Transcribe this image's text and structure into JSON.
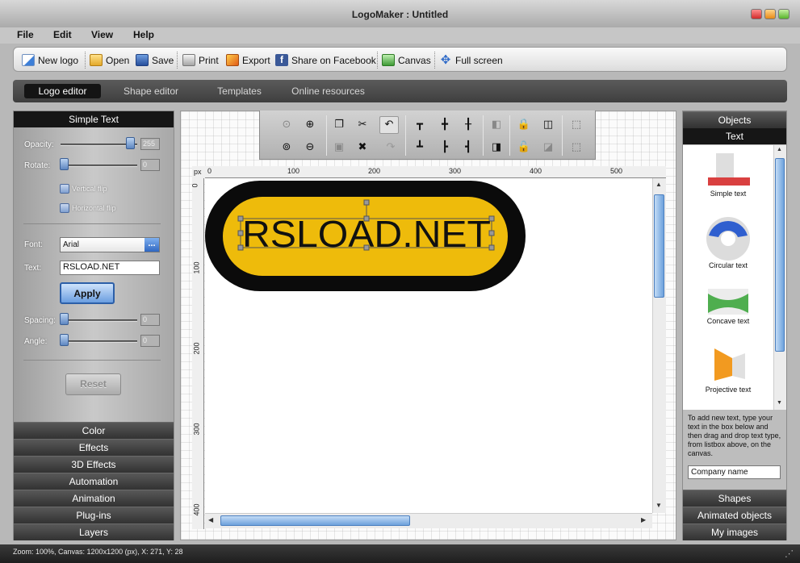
{
  "window": {
    "title": "LogoMaker : Untitled"
  },
  "menu": [
    "File",
    "Edit",
    "View",
    "Help"
  ],
  "toolbar": {
    "new_logo": "New logo",
    "open": "Open",
    "save": "Save",
    "print": "Print",
    "export": "Export",
    "share": "Share on Facebook",
    "canvas": "Canvas",
    "fullscreen": "Full screen"
  },
  "tabs": [
    "Logo editor",
    "Shape editor",
    "Templates",
    "Online resources"
  ],
  "left_panel": {
    "header": "Simple Text",
    "opacity_label": "Opacity:",
    "opacity_value": "255",
    "rotate_label": "Rotate:",
    "rotate_value": "0",
    "vertical_flip": "Vertical flip",
    "horizontal_flip": "Horizontal flip",
    "font_label": "Font:",
    "font_value": "Arial",
    "font_browse": "...",
    "text_label": "Text:",
    "text_value": "RSLOAD.NET",
    "apply": "Apply",
    "spacing_label": "Spacing:",
    "spacing_value": "0",
    "angle_label": "Angle:",
    "angle_value": "0",
    "reset": "Reset",
    "sections": [
      "Color",
      "Effects",
      "3D Effects",
      "Automation",
      "Animation",
      "Plug-ins",
      "Layers"
    ]
  },
  "canvas": {
    "unit": "px",
    "ruler_h": [
      "0",
      "100",
      "200",
      "300",
      "400",
      "500"
    ],
    "ruler_v": [
      "0",
      "100",
      "200",
      "300",
      "400"
    ],
    "logo_text": "RSLOAD.NET",
    "colors": {
      "outer": "#0b0b0b",
      "inner": "#eebb0b",
      "text": "#111111"
    }
  },
  "right_panel": {
    "header": "Objects",
    "subheader": "Text",
    "items": [
      "Simple text",
      "Circular text",
      "Concave text",
      "Projective text"
    ],
    "hint": "To add new text, type your text in the box below and then drag and drop text type, from listbox above, on the canvas.",
    "input_value": "Company name",
    "sections": [
      "Shapes",
      "Animated objects",
      "My images"
    ]
  },
  "status": "Zoom: 100%, Canvas: 1200x1200 (px), X: 271, Y: 28"
}
